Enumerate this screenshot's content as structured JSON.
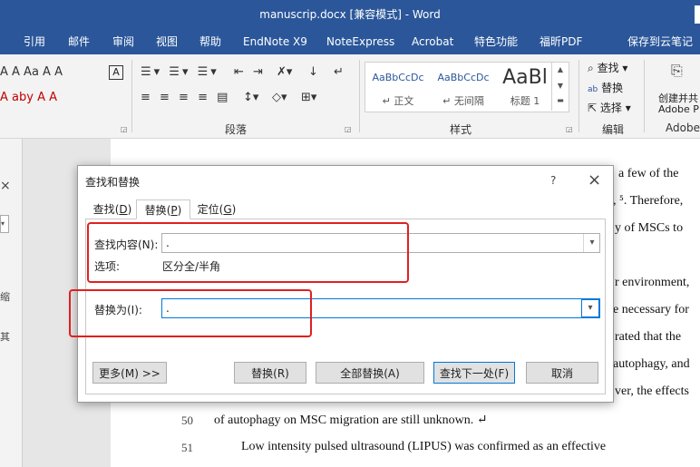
{
  "window": {
    "title": "manuscrip.docx [兼容模式] - Word"
  },
  "ribbon_tabs": [
    "引用",
    "邮件",
    "审阅",
    "视图",
    "帮助",
    "EndNote X9",
    "NoteExpress",
    "Acrobat",
    "特色功能",
    "福昕PDF",
    "保存到云笔记"
  ],
  "ribbon": {
    "font_row1": "A  A   Aa   A   A",
    "font_row2": "A  aby  A   A",
    "paragraph_label": "段落",
    "styles_label": "样式",
    "editing_label": "编辑",
    "adobe_label": "Adobe",
    "styles": [
      {
        "sample": "AaBbCcDc",
        "name": "正文"
      },
      {
        "sample": "AaBbCcDc",
        "name": "无间隔"
      },
      {
        "sample": "AaBl",
        "name": "标题 1"
      }
    ],
    "editing": {
      "find": "查找",
      "replace": "替换",
      "select": "选择"
    },
    "adobe": {
      "line1": "创建并共",
      "line2": "Adobe P"
    }
  },
  "navpane": {
    "close": "×",
    "chars": [
      "缩",
      "其"
    ]
  },
  "document": {
    "right_fragments": [
      "a  few  of  the",
      ", ⁵. Therefore,",
      "y  of  MSCs  to",
      "r environment,",
      "e necessary for",
      "rated  that  the",
      "autophagy,  and",
      "ver, the effects"
    ],
    "lines": [
      {
        "num": "50",
        "text": "of autophagy on MSC migration are still unknown. ↵"
      },
      {
        "num": "51",
        "text": "Low  intensity  pulsed  ultrasound  (LIPUS)  was  confirmed  as  an  effective"
      }
    ]
  },
  "dialog": {
    "title": "查找和替换",
    "help": "?",
    "close": "×",
    "tabs": [
      {
        "label": "查找",
        "key": "D"
      },
      {
        "label": "替换",
        "key": "P"
      },
      {
        "label": "定位",
        "key": "G"
      }
    ],
    "find_label": "查找内容(N):",
    "find_value": ".",
    "options_label": "选项:",
    "options_value": "区分全/半角",
    "replace_label": "替换为(I):",
    "replace_value": ".",
    "buttons": {
      "more": "更多(M) >>",
      "replace": "替换(R)",
      "replace_all": "全部替换(A)",
      "find_next": "查找下一处(F)",
      "cancel": "取消"
    }
  }
}
